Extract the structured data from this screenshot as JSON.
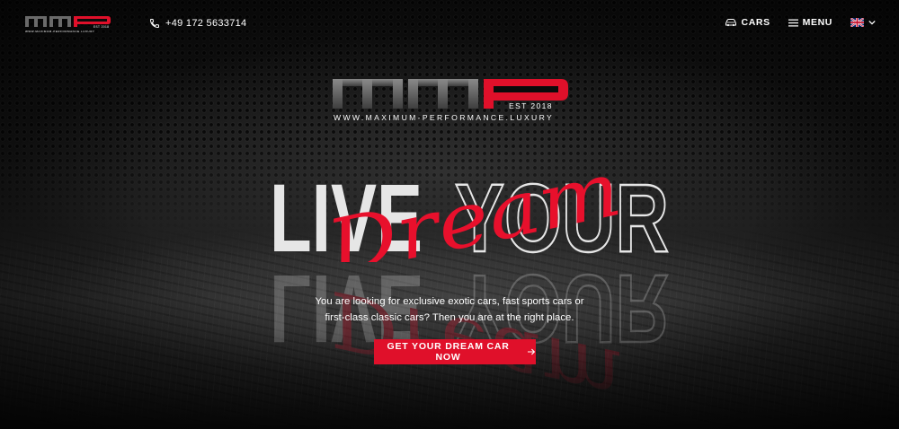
{
  "brand": {
    "logo_letters": "MMP",
    "est": "EST 2018",
    "url": "WWW.MAXIMUM-PERFORMANCE.LUXURY"
  },
  "header": {
    "phone": "+49 172 5633714",
    "nav": {
      "cars_label": "CARS",
      "menu_label": "MENU"
    },
    "language": {
      "selected": "English",
      "flag": "uk-flag-icon"
    }
  },
  "hero": {
    "headline_word_1": "LIVE",
    "headline_word_2": "YOUR",
    "script_word": "Dream",
    "tagline_line_1": "You are looking for exclusive exotic cars, fast sports cars or",
    "tagline_line_2": "first-class classic cars? Then you are at the right place.",
    "cta_label": "GET YOUR DREAM CAR NOW",
    "cta_icon": "arrow-right-icon"
  },
  "colors": {
    "accent_red": "#e0102a",
    "logo_gray": "#5a5a5a",
    "text": "#ffffff",
    "background": "#0b0b0b"
  }
}
